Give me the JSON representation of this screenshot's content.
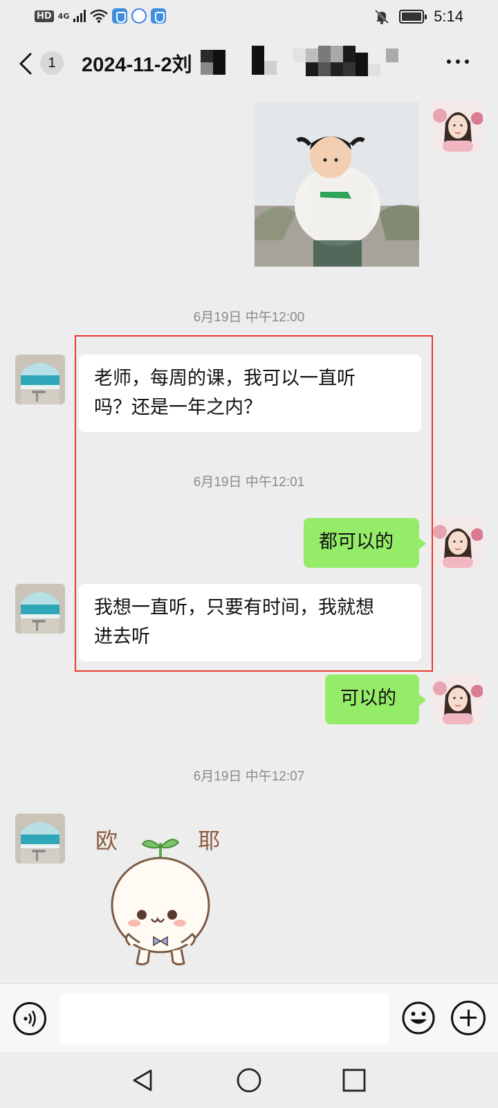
{
  "status_bar": {
    "network_tag": "HD",
    "signal_label": "4G",
    "time": "5:14",
    "icons": [
      "hd-icon",
      "signal-icon",
      "wifi-icon",
      "shield-app-icon",
      "chat-app-icon",
      "shield-app-icon",
      "bell-off-icon",
      "battery-charging-icon"
    ]
  },
  "header": {
    "unread_count": "1",
    "title": "2024-11-2刘",
    "back_icon": "chevron-left-icon",
    "more_icon": "more-dots-icon"
  },
  "messages": [
    {
      "side": "out",
      "type": "image",
      "icon": "photo-sticker"
    },
    {
      "type": "timestamp",
      "text": "6月19日 中午12:00"
    },
    {
      "side": "in",
      "type": "text",
      "lines": [
        "老师，每周的课，我可以一直听",
        "吗？还是一年之内？"
      ]
    },
    {
      "type": "timestamp",
      "text": "6月19日 中午12:01"
    },
    {
      "side": "out",
      "type": "text",
      "lines": [
        "都可以的"
      ]
    },
    {
      "side": "in",
      "type": "text",
      "lines": [
        "我想一直听，只要有时间，我就想",
        "进去听"
      ]
    },
    {
      "side": "out",
      "type": "text",
      "lines": [
        "可以的"
      ]
    },
    {
      "type": "timestamp",
      "text": "6月19日 中午12:07"
    },
    {
      "side": "in",
      "type": "sticker",
      "sticker_text": [
        "欧",
        "耶"
      ]
    }
  ],
  "colors": {
    "background": "#ededed",
    "outgoing_bubble": "#95ec69",
    "incoming_bubble": "#ffffff",
    "highlight_border": "#e8382f"
  },
  "input_bar": {
    "voice_icon": "voice-icon",
    "emoji_icon": "emoji-icon",
    "plus_icon": "plus-icon",
    "input_value": ""
  }
}
